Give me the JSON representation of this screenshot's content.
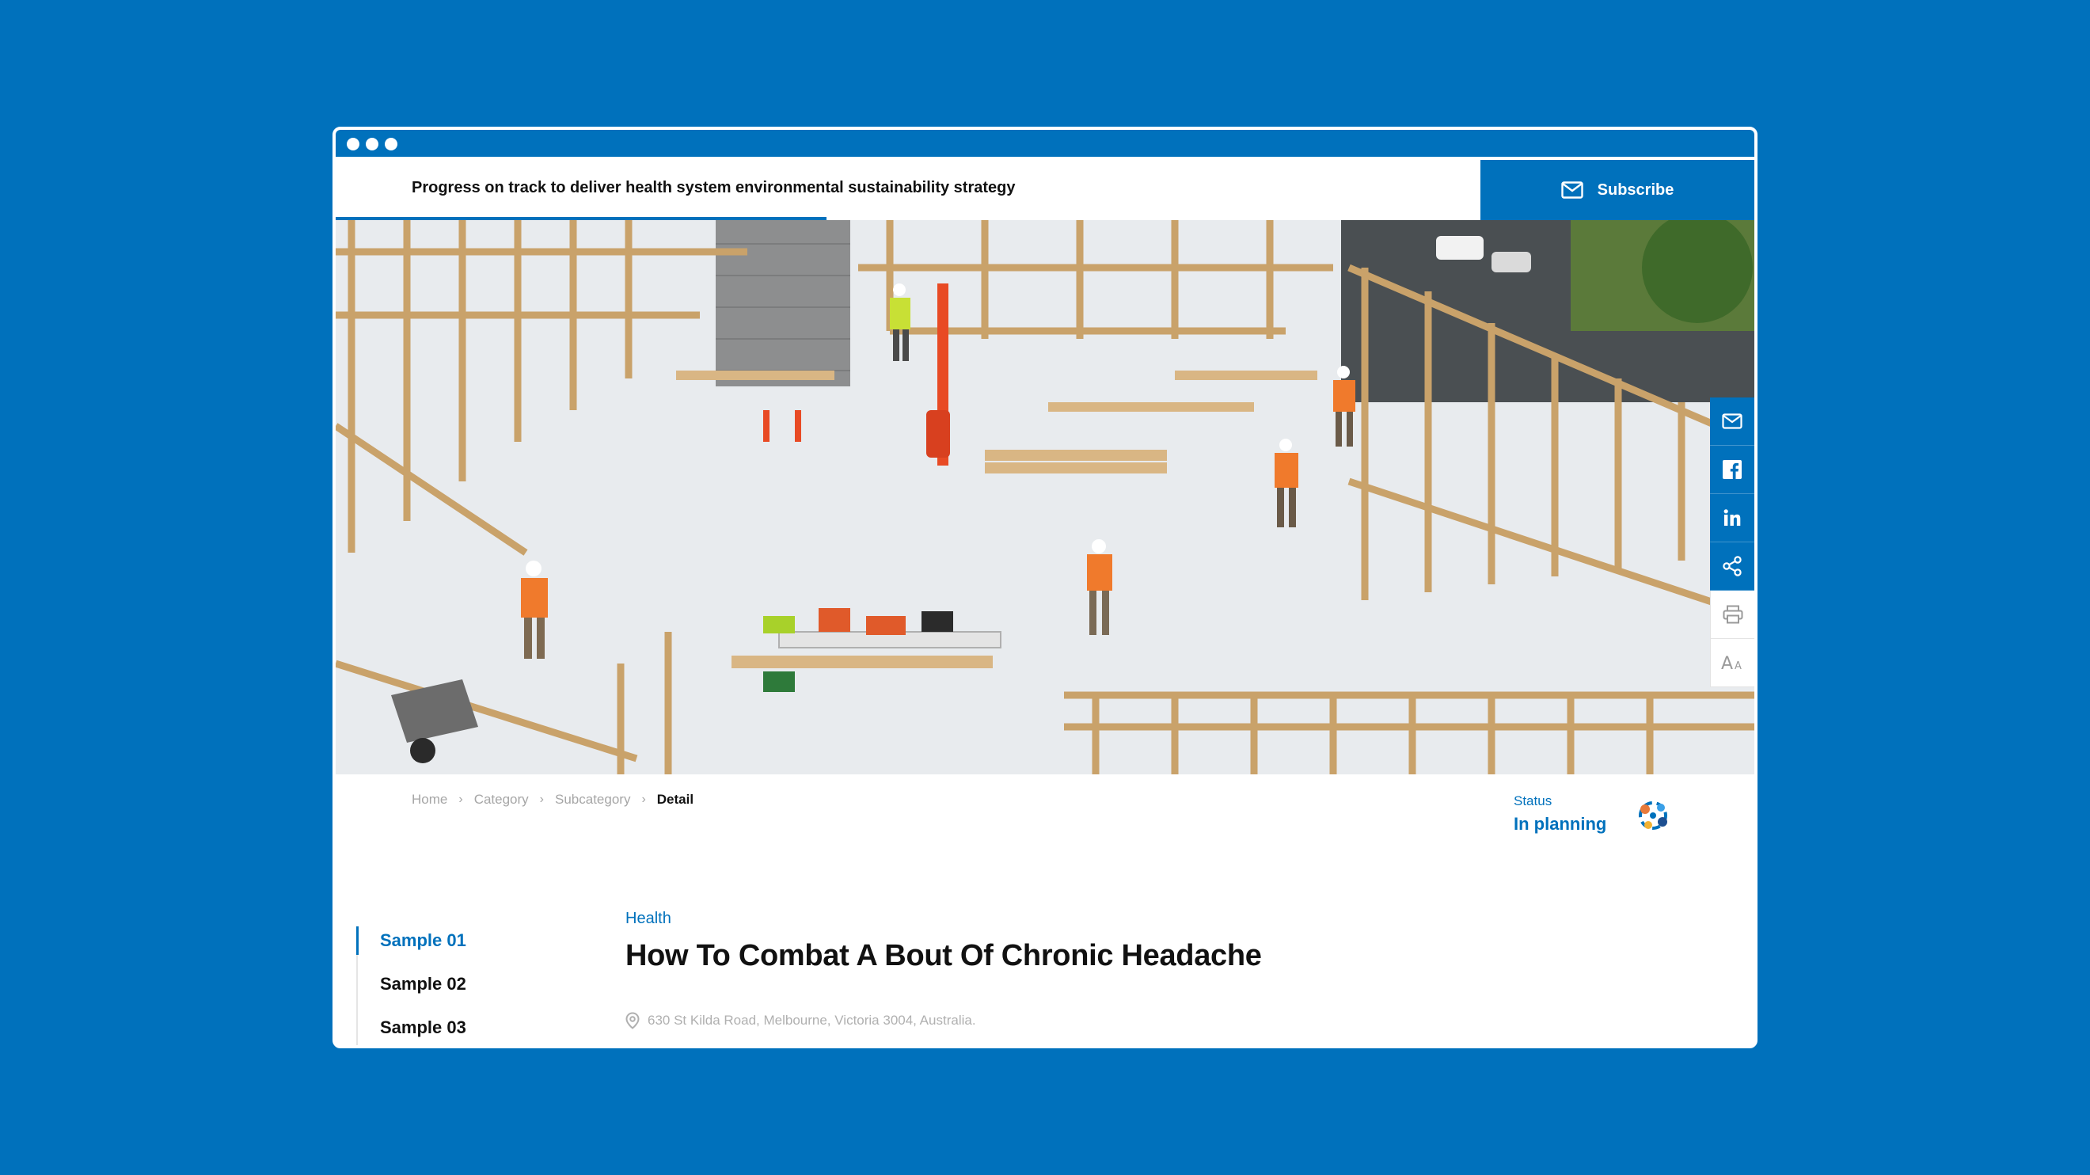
{
  "topbar": {
    "title": "Progress on track to deliver health system environmental sustainability strategy",
    "subscribe_label": "Subscribe"
  },
  "hero": {
    "image_icon": "construction-site-image"
  },
  "share": {
    "items": [
      {
        "name": "email-icon"
      },
      {
        "name": "facebook-icon"
      },
      {
        "name": "linkedin-icon"
      },
      {
        "name": "share-icon"
      },
      {
        "name": "print-icon"
      },
      {
        "name": "text-size-icon"
      }
    ]
  },
  "breadcrumb": {
    "items": [
      "Home",
      "Category",
      "Subcategory"
    ],
    "current": "Detail"
  },
  "status": {
    "label": "Status",
    "value": "In planning"
  },
  "side_nav": {
    "items": [
      "Sample 01",
      "Sample 02",
      "Sample 03"
    ]
  },
  "article": {
    "tag": "Health",
    "title": "How To Combat A Bout Of Chronic Headache",
    "address": "630 St Kilda Road, Melbourne, Victoria 3004, Australia."
  },
  "colors": {
    "brand": "#0071bc",
    "text": "#111111",
    "muted": "#a6a6a6"
  }
}
